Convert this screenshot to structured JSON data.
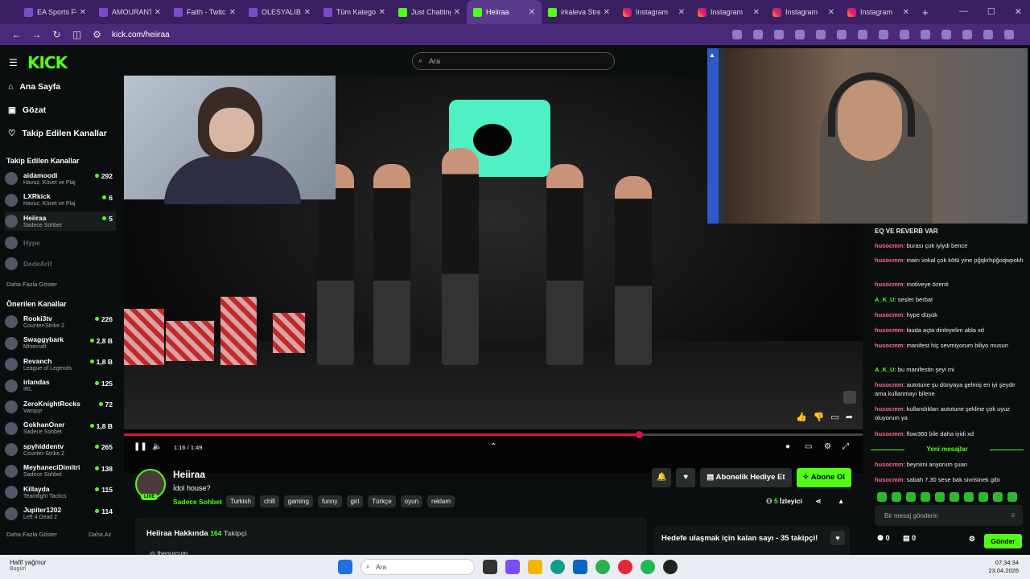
{
  "browser": {
    "tabs": [
      {
        "label": "EA Sports FC",
        "icon": "twitch-icon"
      },
      {
        "label": "AMOURANTH",
        "icon": "twitch-icon"
      },
      {
        "label": "Faith - Twitch",
        "icon": "twitch-icon"
      },
      {
        "label": "OLESYALIBERMAN",
        "icon": "twitch-icon"
      },
      {
        "label": "Tüm Kategoriler",
        "icon": "twitch-icon"
      },
      {
        "label": "Just Chatting",
        "icon": "kick-icon"
      },
      {
        "label": "Heiiraa",
        "icon": "kick-icon",
        "active": true
      },
      {
        "label": "irkaleva Stream",
        "icon": "kick-icon"
      },
      {
        "label": "Instagram",
        "icon": "instagram-icon"
      },
      {
        "label": "Instagram",
        "icon": "instagram-icon"
      },
      {
        "label": "Instagram",
        "icon": "instagram-icon"
      },
      {
        "label": "Instagram",
        "icon": "instagram-icon"
      }
    ],
    "url": "kick.com/heiiraa",
    "accent": "#3b1f63"
  },
  "sidebar": {
    "logo": "KICK",
    "nav": [
      {
        "label": "Ana Sayfa",
        "icon": "home-icon"
      },
      {
        "label": "Gözat",
        "icon": "browse-icon"
      },
      {
        "label": "Takip Edilen Kanallar",
        "icon": "heart-icon"
      }
    ],
    "followed_title": "Takip Edilen Kanallar",
    "followed": [
      {
        "name": "aidamoodi",
        "sub": "Havuz, Küvet ve Plaj",
        "viewers": "292"
      },
      {
        "name": "LXRkick",
        "sub": "Havuz, Küvet ve Plaj",
        "viewers": "6"
      },
      {
        "name": "Heiiraa",
        "sub": "Sadece Sohbet",
        "viewers": "5"
      },
      {
        "name": "Hype",
        "sub": "",
        "viewers": ""
      },
      {
        "name": "DedeArif",
        "sub": "",
        "viewers": ""
      }
    ],
    "more_label": "Daha Fazla Göster",
    "recommended_title": "Önerilen Kanallar",
    "recommended": [
      {
        "name": "Rooki3tv",
        "sub": "Counter-Strike 2",
        "viewers": "226"
      },
      {
        "name": "Swaggybark",
        "sub": "Minecraft",
        "viewers": "2,8 B"
      },
      {
        "name": "Revanch",
        "sub": "League of Legends",
        "viewers": "1,8 B"
      },
      {
        "name": "irlandas",
        "sub": "IRL",
        "viewers": "125"
      },
      {
        "name": "ZeroKnightRocks",
        "sub": "Vampyr",
        "viewers": "72"
      },
      {
        "name": "GokhanOner",
        "sub": "Sadece Sohbet",
        "viewers": "1,8 B"
      },
      {
        "name": "spyhiddentv",
        "sub": "Counter-Strike 2",
        "viewers": "265"
      },
      {
        "name": "MeyhaneciDimitri",
        "sub": "Sadece Sohbet",
        "viewers": "138"
      },
      {
        "name": "Killayda",
        "sub": "Teamfight Tactics",
        "viewers": "115"
      },
      {
        "name": "Jupiter1202",
        "sub": "Left 4 Dead 2",
        "viewers": "114"
      }
    ],
    "more_label2": "Daha Fazla Göster",
    "less_label": "Daha Az"
  },
  "search": {
    "placeholder": "Ara"
  },
  "player": {
    "time": "1:16 / 1:49",
    "progress": 0.697
  },
  "chat": {
    "top_line": "EQ VE REVERB VAR",
    "messages": [
      {
        "user": "husocmm",
        "text": "burası çok iyiydi bence"
      },
      {
        "user": "husocmm",
        "text": "main vokal çok kötü yine pğqkrhpğoqwpokh"
      },
      {
        "user": "husocmm",
        "text": "motiveye özenti"
      },
      {
        "user": "A_K_U",
        "text": "sesler berbat"
      },
      {
        "user": "husocmm",
        "text": "hype düşük"
      },
      {
        "user": "husocmm",
        "text": "lauda açta dinleyelim abla xd"
      },
      {
        "user": "husocmm",
        "text": "manifest hiç sevmiyorum biliyo musun"
      },
      {
        "user": "A_K_U",
        "text": "bu manifestin şeyi mi"
      },
      {
        "user": "husocmm",
        "text": "autotune şu dünyaya gelmiş en iyi şeydir ama kullanmayı bilene"
      },
      {
        "user": "husocmm",
        "text": "kullandıkları autotune şekline çok uyuz oluyorum ya"
      },
      {
        "user": "husocmm",
        "text": "flow360 bile daha iyidi xd"
      }
    ],
    "new_label": "Yeni mesajlar",
    "new_messages": [
      {
        "user": "husocmm",
        "text": "beynimi anyorum şuan"
      },
      {
        "user": "husocmm",
        "text": "sabah 7.30 sese bak sivrisinek gibi"
      }
    ],
    "input_placeholder": "Bir mesaj gönderin",
    "count_a": "0",
    "count_b": "0",
    "send_label": "Gönder"
  },
  "stream": {
    "name": "Heiiraa",
    "title": "İdol house?",
    "live_label": "LIVE",
    "category": "Sadece Sohbet",
    "tags": [
      "Turkish",
      "chill",
      "gaming",
      "funny",
      "girl",
      "Türkçe",
      "oyun",
      "reklam"
    ],
    "gift_label": "Abonelik Hediye Et",
    "subscribe_label": "Abone Ol",
    "viewers": "5",
    "viewers_label": "İzleyici",
    "about_title": "Heiiraa Hakkında",
    "followers": "164",
    "followers_label": "Takipçi",
    "instagram": "thenurcum",
    "goal_text": "Hedefe ulaşmak için kalan sayı - 35 takipçi!",
    "accent": "#53fc18"
  },
  "taskbar": {
    "weather": "Hafif yağmur",
    "weather_sub": "Bugün",
    "search": "Ara",
    "time": "07:34:34",
    "date": "23.04.2026"
  }
}
